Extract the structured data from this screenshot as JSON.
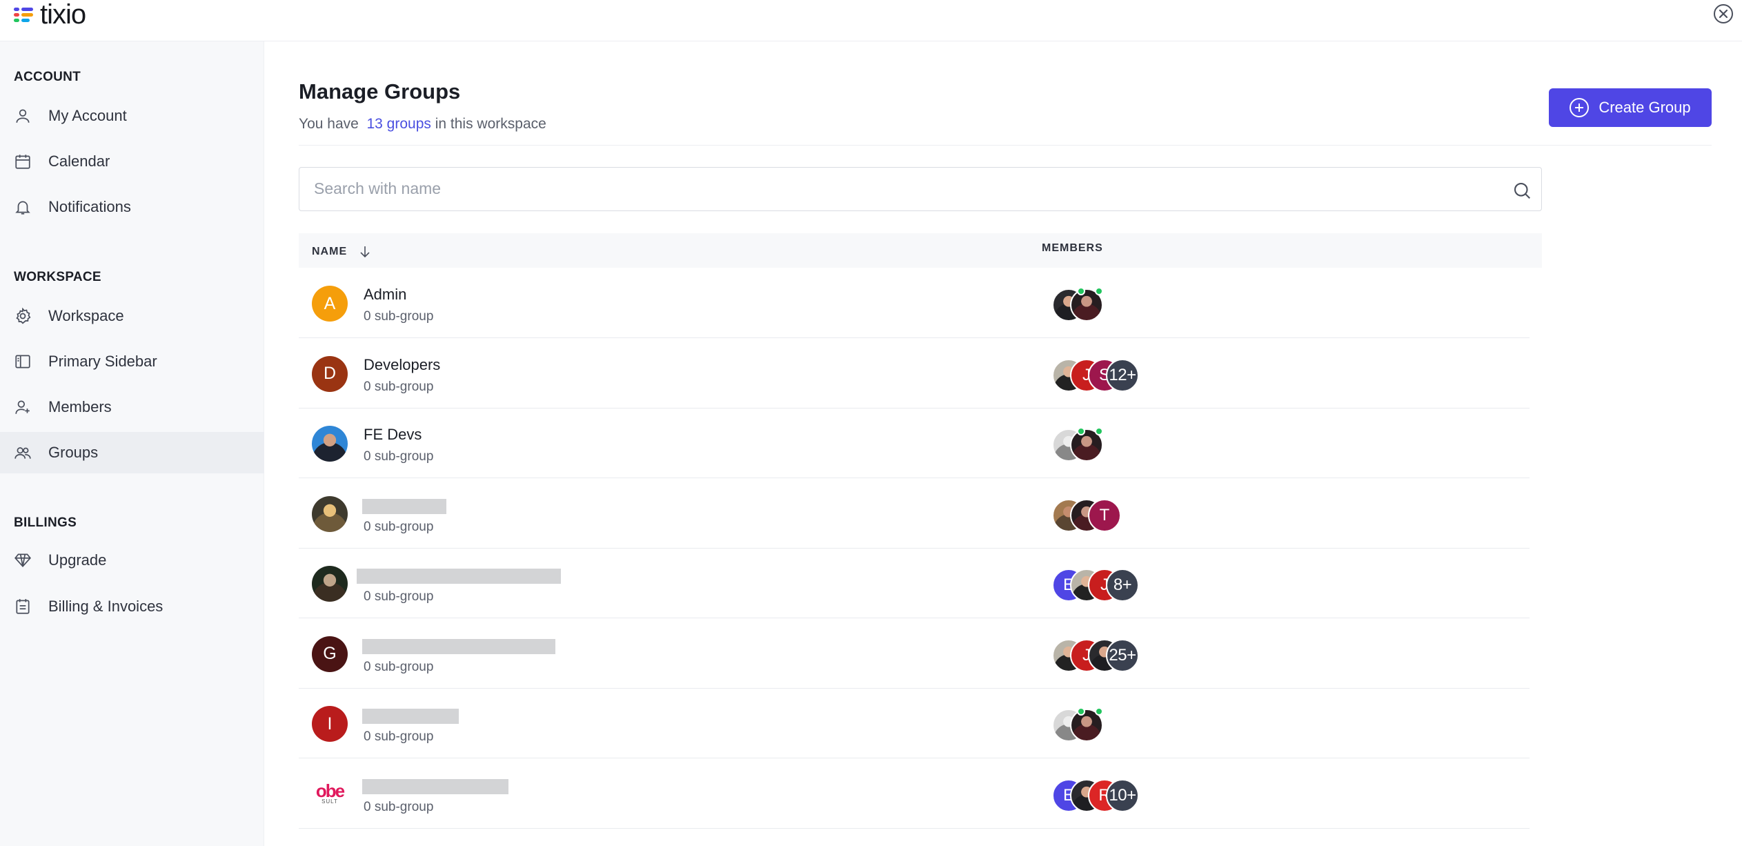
{
  "app": {
    "name": "tixio"
  },
  "sidebar": {
    "sections": [
      {
        "label": "ACCOUNT",
        "items": [
          {
            "label": "My Account",
            "icon": "user-icon"
          },
          {
            "label": "Calendar",
            "icon": "calendar-icon"
          },
          {
            "label": "Notifications",
            "icon": "bell-icon"
          }
        ]
      },
      {
        "label": "WORKSPACE",
        "items": [
          {
            "label": "Workspace",
            "icon": "gear-icon"
          },
          {
            "label": "Primary Sidebar",
            "icon": "sidebar-icon"
          },
          {
            "label": "Members",
            "icon": "user-plus-icon"
          },
          {
            "label": "Groups",
            "icon": "users-icon",
            "active": true
          }
        ]
      },
      {
        "label": "BILLINGS",
        "items": [
          {
            "label": "Upgrade",
            "icon": "diamond-icon"
          },
          {
            "label": "Billing & Invoices",
            "icon": "invoice-icon"
          }
        ]
      }
    ]
  },
  "main": {
    "title": "Manage Groups",
    "subtitle_prefix": "You have",
    "subtitle_link": "13 groups",
    "subtitle_suffix": "in this workspace",
    "create_button_label": "Create Group",
    "search_placeholder": "Search with name",
    "columns": {
      "name": "NAME",
      "members": "MEMBERS"
    },
    "groups": [
      {
        "name": "Admin",
        "sub": "0 sub-group",
        "avatar_letter": "A",
        "avatar_color": "#f59e0b",
        "members": [
          {
            "type": "photo",
            "style": "photo-a",
            "online": true
          },
          {
            "type": "photo",
            "style": "photo-b",
            "online": true
          }
        ]
      },
      {
        "name": "Developers",
        "sub": "0 sub-group",
        "avatar_letter": "D",
        "avatar_color": "#9a3412",
        "members": [
          {
            "type": "photo",
            "style": "photo-c"
          },
          {
            "type": "letter",
            "letter": "J",
            "color": "#c81e1e"
          },
          {
            "type": "letter",
            "letter": "S",
            "color": "#9d174d"
          },
          {
            "type": "count",
            "text": "12+"
          }
        ]
      },
      {
        "name": "FE Devs",
        "sub": "0 sub-group",
        "avatar_photo": "photo-fe",
        "members": [
          {
            "type": "photo",
            "style": "photo-d",
            "online": true
          },
          {
            "type": "photo",
            "style": "photo-b",
            "online": true
          }
        ]
      },
      {
        "name": "",
        "sub": "0 sub-group",
        "avatar_photo": "photo-g4",
        "redacted": true,
        "members": [
          {
            "type": "photo",
            "style": "photo-e"
          },
          {
            "type": "photo",
            "style": "photo-b"
          },
          {
            "type": "letter",
            "letter": "T",
            "color": "#9d174d"
          }
        ]
      },
      {
        "name": "",
        "sub": "0 sub-group",
        "avatar_photo": "photo-g5",
        "redacted": true,
        "members": [
          {
            "type": "letter",
            "letter": "E",
            "color": "#4f46e5"
          },
          {
            "type": "photo",
            "style": "photo-c"
          },
          {
            "type": "letter",
            "letter": "J",
            "color": "#c81e1e"
          },
          {
            "type": "count",
            "text": "8+"
          }
        ]
      },
      {
        "name": "",
        "sub": "0 sub-group",
        "avatar_letter": "G",
        "avatar_color": "#4a1414",
        "redacted": true,
        "members": [
          {
            "type": "photo",
            "style": "photo-c"
          },
          {
            "type": "letter",
            "letter": "J",
            "color": "#c81e1e"
          },
          {
            "type": "photo",
            "style": "photo-a"
          },
          {
            "type": "count",
            "text": "25+"
          }
        ]
      },
      {
        "name": "",
        "sub": "0 sub-group",
        "avatar_letter": "I",
        "avatar_color": "#b91c1c",
        "redacted": true,
        "members": [
          {
            "type": "photo",
            "style": "photo-d",
            "online": true
          },
          {
            "type": "photo",
            "style": "photo-b",
            "online": true
          }
        ]
      },
      {
        "name": "",
        "sub": "0 sub-group",
        "avatar_logo": true,
        "redacted": true,
        "members": [
          {
            "type": "letter",
            "letter": "E",
            "color": "#4f46e5"
          },
          {
            "type": "photo",
            "style": "photo-a"
          },
          {
            "type": "letter",
            "letter": "R",
            "color": "#dc2626"
          },
          {
            "type": "count",
            "text": "10+"
          }
        ]
      }
    ]
  },
  "colors": {
    "accent": "#4f46e5",
    "link": "#4a4fe0",
    "online": "#22c55e",
    "sidebar_bg": "#f7f8fa"
  }
}
